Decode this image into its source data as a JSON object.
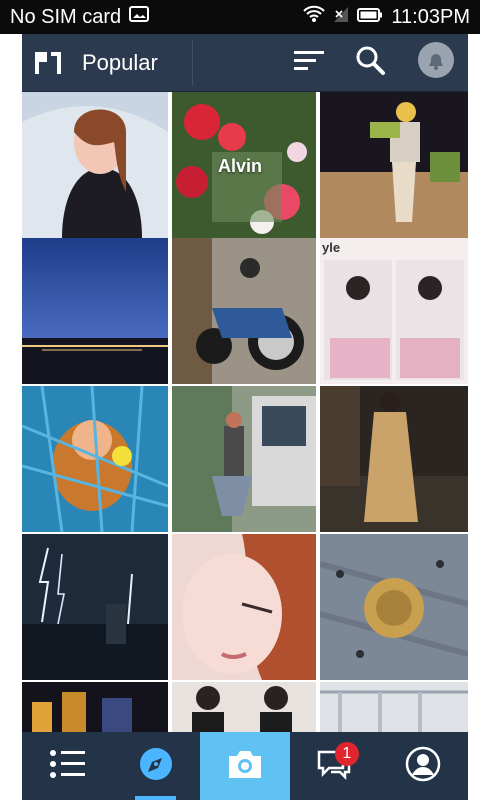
{
  "status": {
    "carrier": "No SIM card",
    "time": "11:03PM"
  },
  "header": {
    "title": "Popular",
    "icons": [
      "app-logo-icon",
      "sort-icon",
      "search-icon",
      "profile-notification-icon"
    ]
  },
  "grid": {
    "tile_captions": {
      "flowers": "Alvin",
      "sketch": "yle"
    }
  },
  "tabs": [
    {
      "name": "feed-list",
      "icon": "list-icon"
    },
    {
      "name": "explore",
      "icon": "compass-icon",
      "active": true
    },
    {
      "name": "camera",
      "icon": "camera-icon"
    },
    {
      "name": "messages",
      "icon": "chat-icon",
      "badge": "1"
    },
    {
      "name": "profile",
      "icon": "user-icon"
    }
  ],
  "colors": {
    "header_bg": "#2b3a4f",
    "tabbar_bg": "#243448",
    "camera_tab_bg": "#5fc2f3",
    "accent": "#4bb5ff",
    "badge": "#e0252e"
  }
}
